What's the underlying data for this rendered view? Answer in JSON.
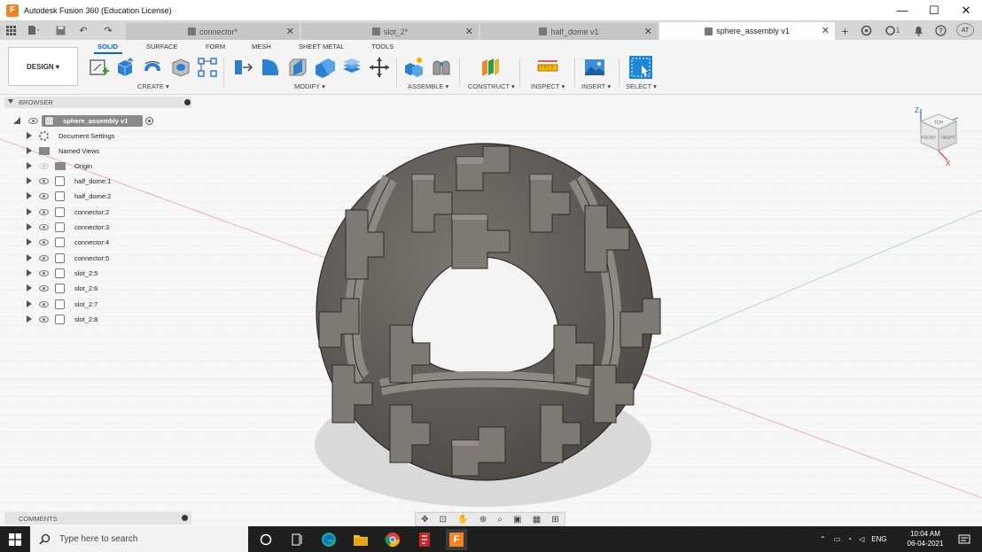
{
  "window": {
    "title": "Autodesk Fusion 360 (Education License)",
    "controls": {
      "minimize": "—",
      "maximize": "☐",
      "close": "✕"
    }
  },
  "tabs": [
    {
      "label": "connector*",
      "active": false
    },
    {
      "label": "slot_2*",
      "active": false
    },
    {
      "label": "half_dome v1",
      "active": false
    },
    {
      "label": "sphere_assembly v1",
      "active": true
    }
  ],
  "tab_actions": {
    "new_tab": "+",
    "job_count": "1",
    "user_initials": "AT",
    "help": "?"
  },
  "ribbon": {
    "workspace": "DESIGN ▾",
    "tabs": [
      "SOLID",
      "SURFACE",
      "FORM",
      "MESH",
      "SHEET METAL",
      "TOOLS"
    ],
    "groups": [
      "CREATE ▾",
      "MODIFY ▾",
      "ASSEMBLE ▾",
      "CONSTRUCT ▾",
      "INSPECT ▾",
      "INSERT ▾",
      "SELECT ▾"
    ]
  },
  "browser": {
    "header": "BROWSER",
    "root": "sphere_assembly v1",
    "items": [
      {
        "label": "Document Settings",
        "icon": "gear-icon"
      },
      {
        "label": "Named Views",
        "icon": "folder-icon"
      },
      {
        "label": "Origin",
        "icon": "folder-icon"
      },
      {
        "label": "half_dome:1",
        "icon": "link-component-icon"
      },
      {
        "label": "half_dome:2",
        "icon": "link-component-icon"
      },
      {
        "label": "connector:2",
        "icon": "component-icon"
      },
      {
        "label": "connector:3",
        "icon": "component-icon"
      },
      {
        "label": "connector:4",
        "icon": "component-icon"
      },
      {
        "label": "connector:5",
        "icon": "component-icon"
      },
      {
        "label": "slot_2:5",
        "icon": "component-icon"
      },
      {
        "label": "slot_2:6",
        "icon": "component-icon"
      },
      {
        "label": "slot_2:7",
        "icon": "component-icon"
      },
      {
        "label": "slot_2:8",
        "icon": "component-icon"
      }
    ]
  },
  "comments": {
    "label": "COMMENTS"
  },
  "viewcube": {
    "axis_z": "Z",
    "axis_x": "X",
    "face_top": "TOP",
    "face_front": "FRONT",
    "face_right": "RIGHT"
  },
  "taskbar": {
    "search_placeholder": "Type here to search",
    "language": "ENG",
    "time": "10:04 AM",
    "date": "06-04-2021"
  },
  "colors": {
    "accent": "#0a6ab8",
    "model": "#6b6560",
    "taskbar": "#1f1f1f"
  }
}
